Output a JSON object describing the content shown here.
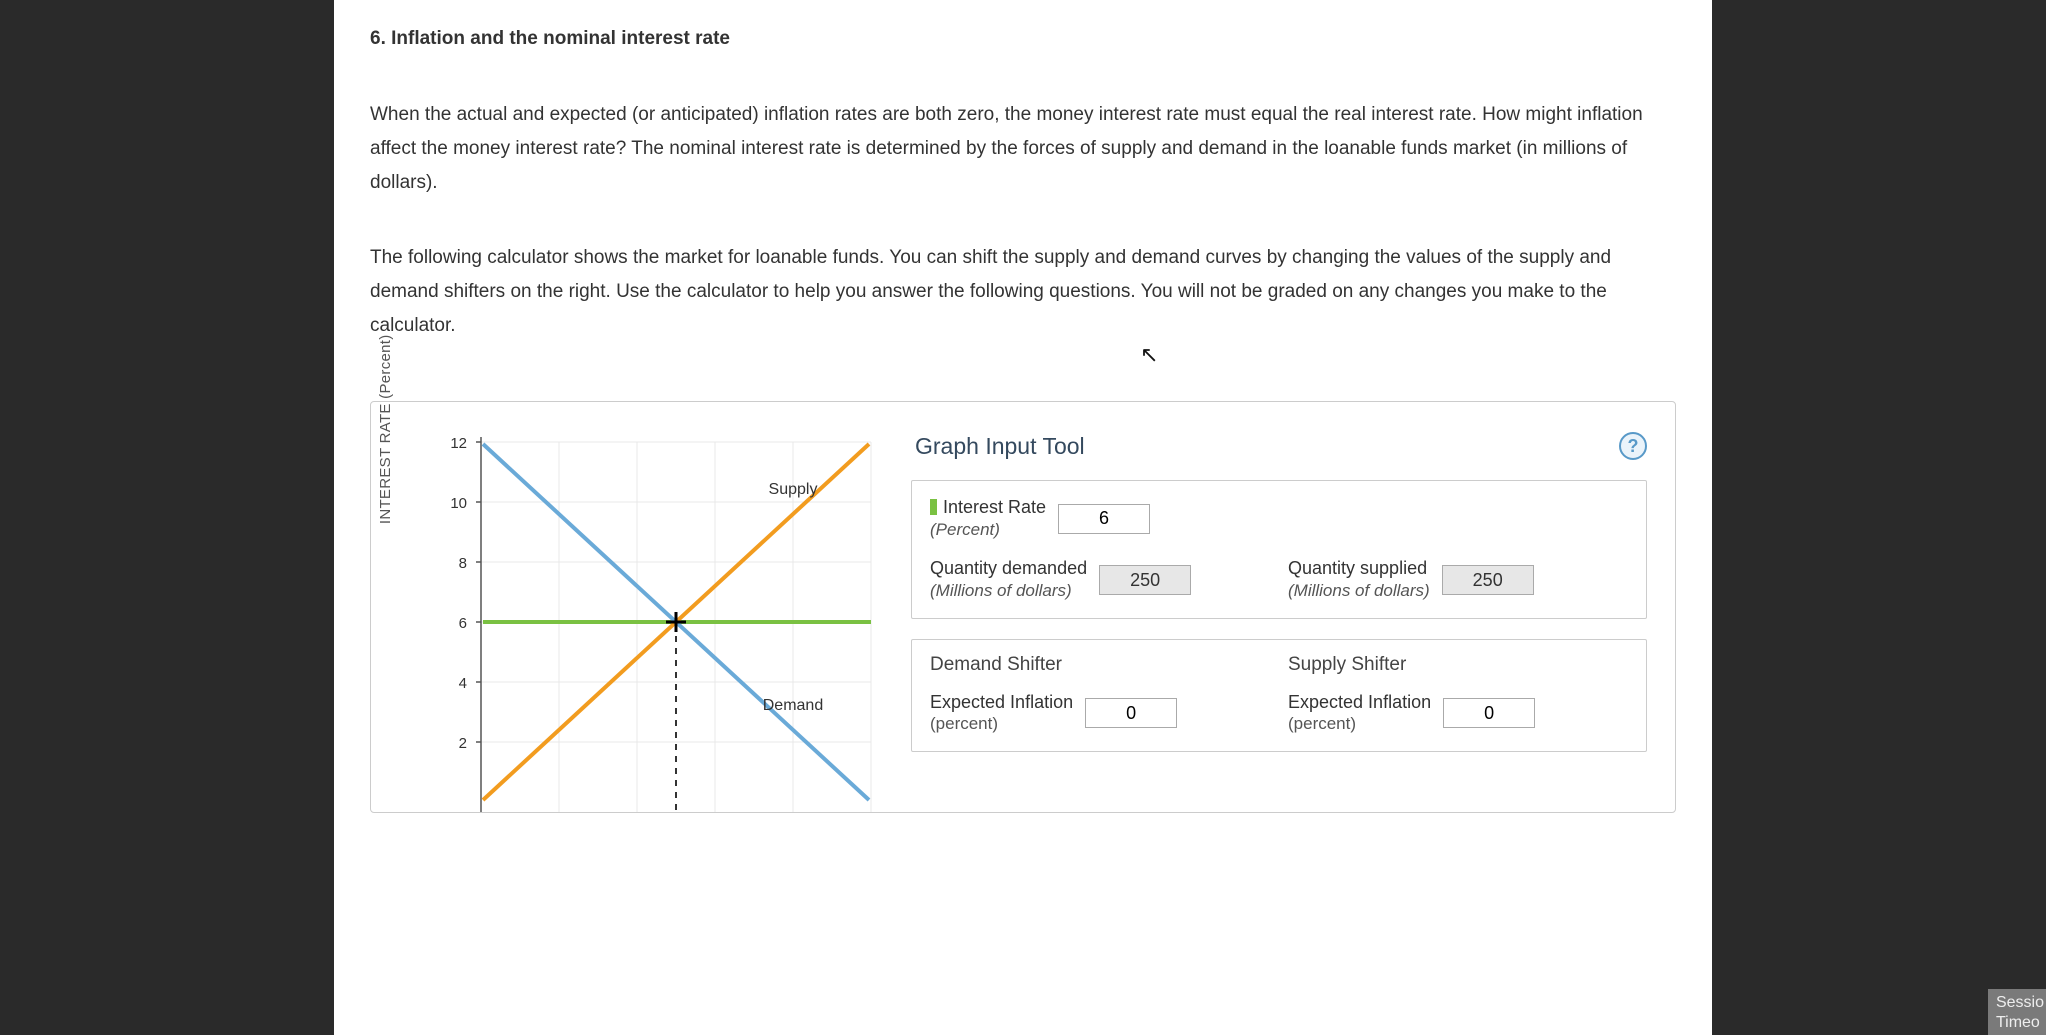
{
  "question": {
    "title": "6. Inflation and the nominal interest rate",
    "para1": "When the actual and expected (or anticipated) inflation rates are both zero, the money interest rate must equal the real interest rate. How might inflation affect the money interest rate? The nominal interest rate is determined by the forces of supply and demand in the loanable funds market (in millions of dollars).",
    "para2": "The following calculator shows the market for loanable funds. You can shift the supply and demand curves by changing the values of the supply and demand shifters on the right. Use the calculator to help you answer the following questions. You will not be graded on any changes you make to the calculator."
  },
  "tool": {
    "title": "Graph Input Tool",
    "help": "?",
    "interest_rate": {
      "label": "Interest Rate",
      "unit": "(Percent)",
      "value": "6"
    },
    "qty_demanded": {
      "label": "Quantity demanded",
      "unit": "(Millions of dollars)",
      "value": "250"
    },
    "qty_supplied": {
      "label": "Quantity supplied",
      "unit": "(Millions of dollars)",
      "value": "250"
    },
    "demand_shifter_title": "Demand Shifter",
    "supply_shifter_title": "Supply Shifter",
    "demand_shifter": {
      "label": "Expected Inflation",
      "unit": "(percent)",
      "value": "0"
    },
    "supply_shifter": {
      "label": "Expected Inflation",
      "unit": "(percent)",
      "value": "0"
    }
  },
  "session": {
    "line1": "Sessio",
    "line2": "Timeo"
  },
  "chart_data": {
    "type": "line",
    "ylabel": "INTEREST RATE (Percent)",
    "y_ticks": [
      2,
      4,
      6,
      8,
      10,
      12
    ],
    "ylim": [
      0,
      12
    ],
    "xlim": [
      0,
      500
    ],
    "equilibrium": {
      "x": 250,
      "y": 6
    },
    "series": [
      {
        "name": "Supply",
        "color": "#f29c1f",
        "points": [
          [
            0,
            0
          ],
          [
            500,
            12
          ]
        ]
      },
      {
        "name": "Demand",
        "color": "#6aaad8",
        "points": [
          [
            0,
            12
          ],
          [
            500,
            0
          ]
        ]
      },
      {
        "name": "Equilibrium",
        "color": "#7ac142",
        "points": [
          [
            0,
            6
          ],
          [
            500,
            6
          ]
        ]
      }
    ],
    "labels": {
      "supply": "Supply",
      "demand": "Demand"
    }
  }
}
